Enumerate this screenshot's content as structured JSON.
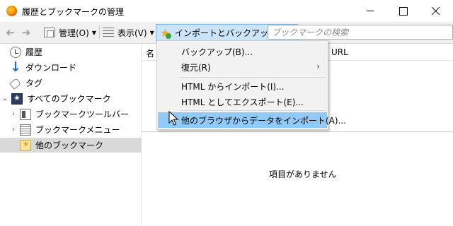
{
  "window": {
    "title": "履歴とブックマークの管理"
  },
  "toolbar": {
    "organize_label": "管理(O)",
    "views_label": "表示(V)",
    "import_backup_label": "インポートとバックアップ(I)",
    "search_placeholder": "ブックマークの検索"
  },
  "sidebar": {
    "items": [
      {
        "label": "履歴",
        "icon": "history-icon"
      },
      {
        "label": "ダウンロード",
        "icon": "download-icon"
      },
      {
        "label": "タグ",
        "icon": "tag-icon"
      },
      {
        "label": "すべてのブックマーク",
        "icon": "all-bookmarks-icon",
        "expanded": true
      },
      {
        "label": "ブックマークツールバー",
        "icon": "bookmarks-toolbar-icon"
      },
      {
        "label": "ブックマークメニュー",
        "icon": "bookmarks-menu-icon"
      },
      {
        "label": "他のブックマーク",
        "icon": "other-bookmarks-icon",
        "selected": true
      }
    ]
  },
  "list": {
    "columns": [
      "名",
      "URL"
    ],
    "empty_message": "項目がありません"
  },
  "menu": {
    "items": [
      {
        "label": "バックアップ(B)..."
      },
      {
        "label": "復元(R)",
        "has_submenu": true
      },
      {
        "label": "HTML からインポート(I)..."
      },
      {
        "label": "HTML としてエクスポート(E)..."
      },
      {
        "label": "他のブラウザからデータをインポート(A)...",
        "highlighted": true
      }
    ]
  },
  "colors": {
    "highlight": "#91c9f7",
    "pressed_button": "#cce4f7",
    "selected_row": "#d9d9d9"
  }
}
